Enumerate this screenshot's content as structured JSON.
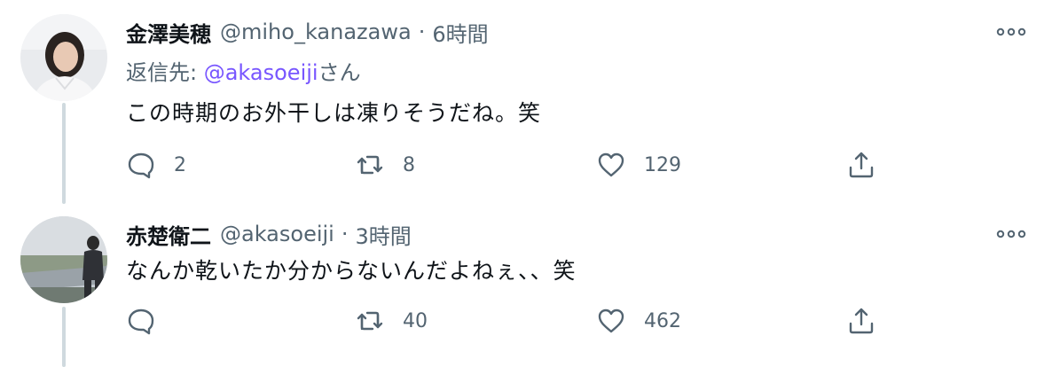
{
  "tweets": [
    {
      "display_name": "金澤美穂",
      "handle": "@miho_kanazawa",
      "separator": "·",
      "time": "6時間",
      "reply_label": "返信先: ",
      "reply_mention": "@akasoeiji",
      "reply_suffix": "さん",
      "text": "この時期のお外干しは凍りそうだね。笑",
      "replies": "2",
      "retweets": "8",
      "likes": "129"
    },
    {
      "display_name": "赤楚衛二",
      "handle": "@akasoeiji",
      "separator": "·",
      "time": "3時間",
      "text": "なんか乾いたか分からないんだよねぇ、、笑",
      "replies": "",
      "retweets": "40",
      "likes": "462"
    }
  ],
  "icons": {
    "reply": "speech-bubble-icon",
    "retweet": "retweet-icon",
    "like": "heart-icon",
    "share": "share-icon",
    "more": "more-dots-icon"
  },
  "colors": {
    "text": "#0f1419",
    "secondary": "#536471",
    "mention": "#7856ff",
    "thread_line": "#cfd9de"
  }
}
